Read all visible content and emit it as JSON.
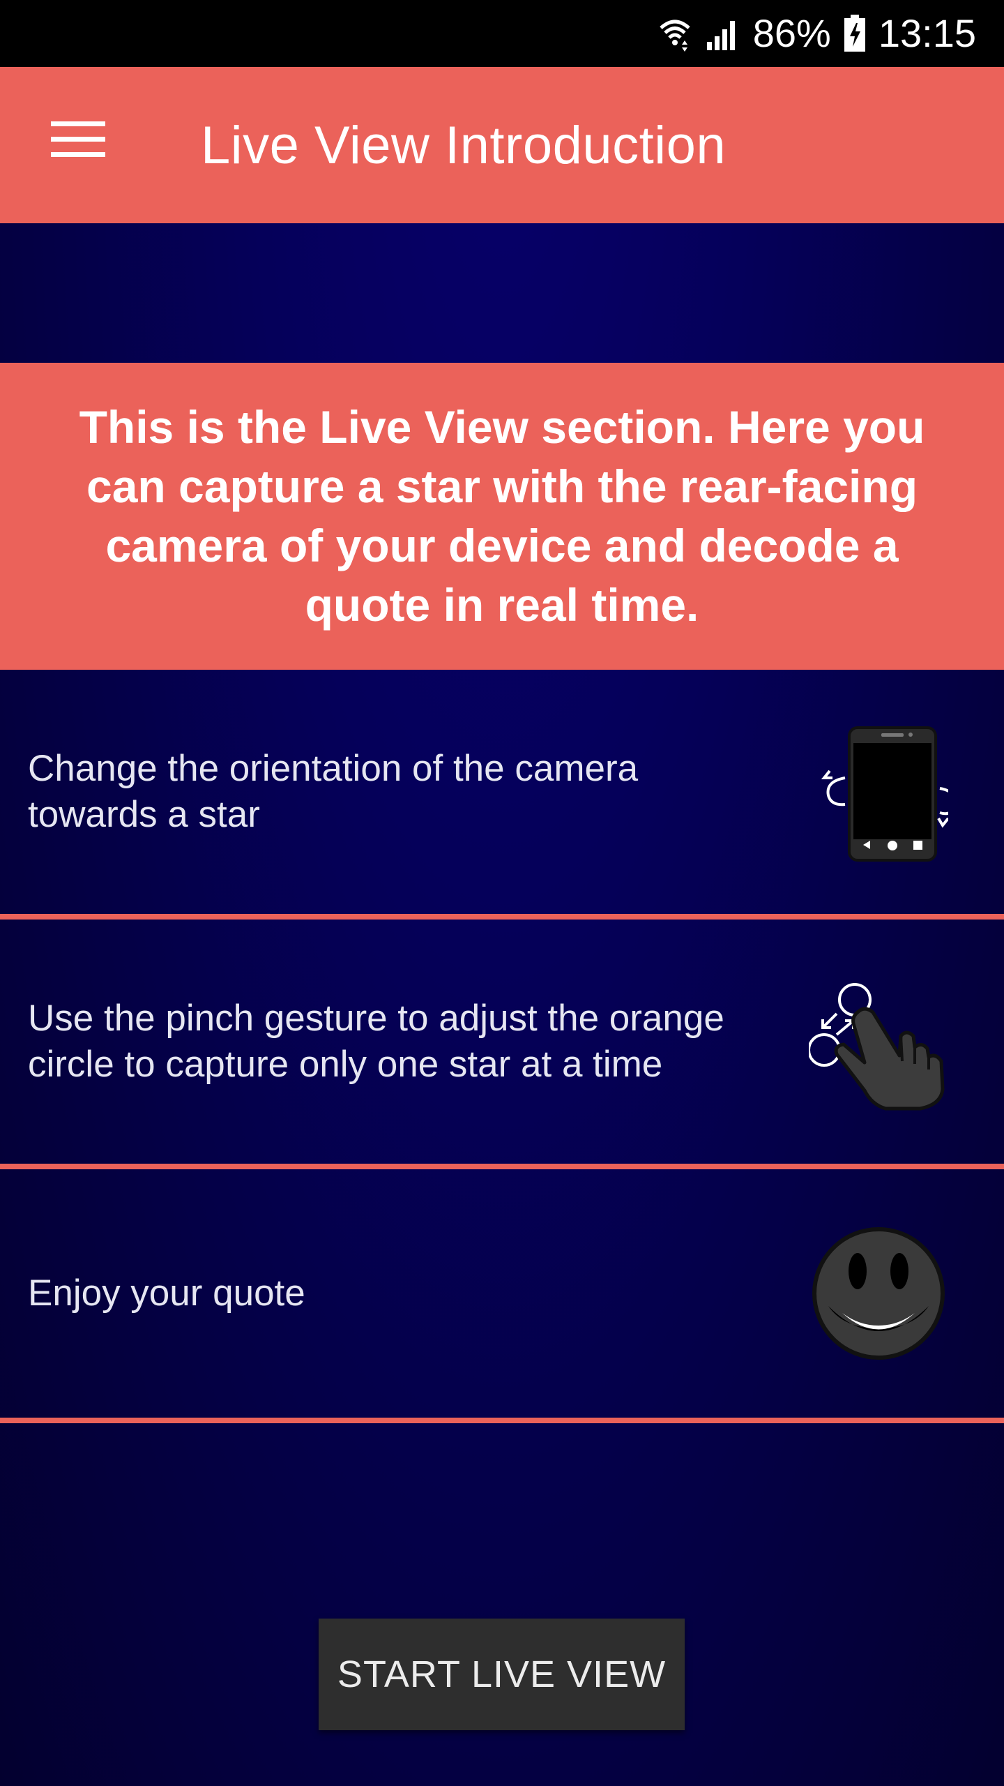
{
  "status_bar": {
    "battery": "86%",
    "time": "13:15",
    "icons": [
      "wifi-icon",
      "signal-icon",
      "battery-charging-icon"
    ]
  },
  "app_bar": {
    "menu_icon": "hamburger-menu-icon",
    "title": "Live View Introduction",
    "color": "#eb625a"
  },
  "intro": {
    "text": "This is the Live View section. Here you can capture a star with the rear-facing camera of your device and decode a quote in real time."
  },
  "steps": [
    {
      "text": "Change the orientation of the camera towards a star",
      "icon": "rotate-phone-icon"
    },
    {
      "text": "Use the pinch gesture to adjust the orange circle to capture only one star at a time",
      "icon": "pinch-gesture-icon"
    },
    {
      "text": "Enjoy your quote",
      "icon": "smiley-face-icon"
    }
  ],
  "start_button": {
    "label": "START LIVE VIEW"
  },
  "colors": {
    "accent": "#eb625a",
    "background": "#05005a",
    "button": "#2e2e2e"
  }
}
